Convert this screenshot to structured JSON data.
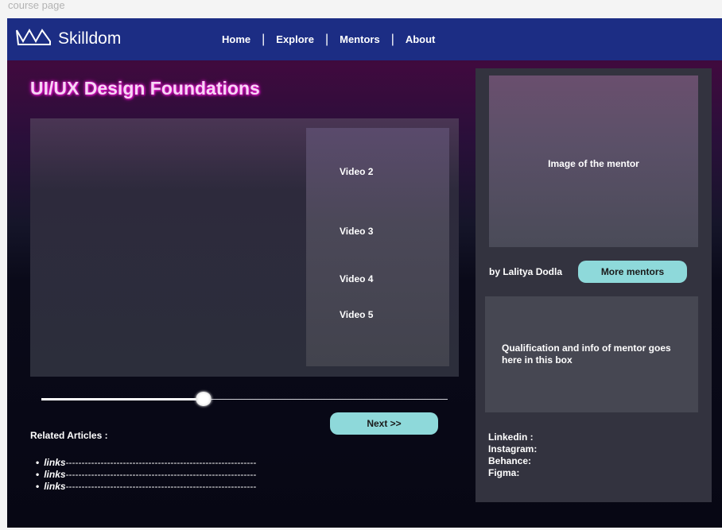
{
  "frame": {
    "label": "course page"
  },
  "header": {
    "brand": "Skilldom",
    "nav": [
      {
        "label": "Home"
      },
      {
        "label": "Explore"
      },
      {
        "label": "Mentors"
      },
      {
        "label": "About"
      }
    ],
    "separator": "|"
  },
  "course": {
    "title": "UI/UX Design Foundations"
  },
  "playlist": [
    {
      "label": "Video 2"
    },
    {
      "label": "Video 3"
    },
    {
      "label": "Video 4"
    },
    {
      "label": "Video 5"
    }
  ],
  "progress": {
    "fraction": 0.4
  },
  "actions": {
    "next_label": "Next >>"
  },
  "related": {
    "title": "Related Articles :",
    "links": [
      {
        "label": "links",
        "dashes": "------------------------------------------------------------"
      },
      {
        "label": "links",
        "dashes": "------------------------------------------------------------"
      },
      {
        "label": "links",
        "dashes": "------------------------------------------------------------"
      }
    ]
  },
  "mentor": {
    "image_label": "Image of the mentor",
    "byline": "by Lalitya Dodla",
    "more_label": "More mentors",
    "info_text": "Qualification and info of mentor goes here in this box",
    "socials": [
      {
        "label": "Linkedin :"
      },
      {
        "label": "Instagram:"
      },
      {
        "label": "Behance:"
      },
      {
        "label": "Figma:"
      }
    ]
  },
  "colors": {
    "navbar": "#1c2d84",
    "accent_button": "#8ed9da",
    "title_glow": "#e61bd0"
  },
  "icons": {
    "logo": "crown-icon",
    "bullet": "bullet-dot"
  }
}
